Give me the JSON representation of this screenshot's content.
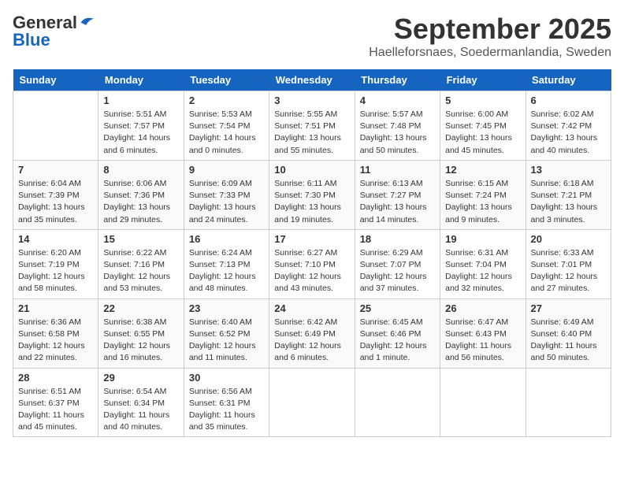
{
  "header": {
    "logo_line1": "General",
    "logo_line2": "Blue",
    "month": "September 2025",
    "location": "Haelleforsnaes, Soedermanlandia, Sweden"
  },
  "columns": [
    "Sunday",
    "Monday",
    "Tuesday",
    "Wednesday",
    "Thursday",
    "Friday",
    "Saturday"
  ],
  "weeks": [
    [
      {
        "day": "",
        "info": ""
      },
      {
        "day": "1",
        "info": "Sunrise: 5:51 AM\nSunset: 7:57 PM\nDaylight: 14 hours\nand 6 minutes."
      },
      {
        "day": "2",
        "info": "Sunrise: 5:53 AM\nSunset: 7:54 PM\nDaylight: 14 hours\nand 0 minutes."
      },
      {
        "day": "3",
        "info": "Sunrise: 5:55 AM\nSunset: 7:51 PM\nDaylight: 13 hours\nand 55 minutes."
      },
      {
        "day": "4",
        "info": "Sunrise: 5:57 AM\nSunset: 7:48 PM\nDaylight: 13 hours\nand 50 minutes."
      },
      {
        "day": "5",
        "info": "Sunrise: 6:00 AM\nSunset: 7:45 PM\nDaylight: 13 hours\nand 45 minutes."
      },
      {
        "day": "6",
        "info": "Sunrise: 6:02 AM\nSunset: 7:42 PM\nDaylight: 13 hours\nand 40 minutes."
      }
    ],
    [
      {
        "day": "7",
        "info": "Sunrise: 6:04 AM\nSunset: 7:39 PM\nDaylight: 13 hours\nand 35 minutes."
      },
      {
        "day": "8",
        "info": "Sunrise: 6:06 AM\nSunset: 7:36 PM\nDaylight: 13 hours\nand 29 minutes."
      },
      {
        "day": "9",
        "info": "Sunrise: 6:09 AM\nSunset: 7:33 PM\nDaylight: 13 hours\nand 24 minutes."
      },
      {
        "day": "10",
        "info": "Sunrise: 6:11 AM\nSunset: 7:30 PM\nDaylight: 13 hours\nand 19 minutes."
      },
      {
        "day": "11",
        "info": "Sunrise: 6:13 AM\nSunset: 7:27 PM\nDaylight: 13 hours\nand 14 minutes."
      },
      {
        "day": "12",
        "info": "Sunrise: 6:15 AM\nSunset: 7:24 PM\nDaylight: 13 hours\nand 9 minutes."
      },
      {
        "day": "13",
        "info": "Sunrise: 6:18 AM\nSunset: 7:21 PM\nDaylight: 13 hours\nand 3 minutes."
      }
    ],
    [
      {
        "day": "14",
        "info": "Sunrise: 6:20 AM\nSunset: 7:19 PM\nDaylight: 12 hours\nand 58 minutes."
      },
      {
        "day": "15",
        "info": "Sunrise: 6:22 AM\nSunset: 7:16 PM\nDaylight: 12 hours\nand 53 minutes."
      },
      {
        "day": "16",
        "info": "Sunrise: 6:24 AM\nSunset: 7:13 PM\nDaylight: 12 hours\nand 48 minutes."
      },
      {
        "day": "17",
        "info": "Sunrise: 6:27 AM\nSunset: 7:10 PM\nDaylight: 12 hours\nand 43 minutes."
      },
      {
        "day": "18",
        "info": "Sunrise: 6:29 AM\nSunset: 7:07 PM\nDaylight: 12 hours\nand 37 minutes."
      },
      {
        "day": "19",
        "info": "Sunrise: 6:31 AM\nSunset: 7:04 PM\nDaylight: 12 hours\nand 32 minutes."
      },
      {
        "day": "20",
        "info": "Sunrise: 6:33 AM\nSunset: 7:01 PM\nDaylight: 12 hours\nand 27 minutes."
      }
    ],
    [
      {
        "day": "21",
        "info": "Sunrise: 6:36 AM\nSunset: 6:58 PM\nDaylight: 12 hours\nand 22 minutes."
      },
      {
        "day": "22",
        "info": "Sunrise: 6:38 AM\nSunset: 6:55 PM\nDaylight: 12 hours\nand 16 minutes."
      },
      {
        "day": "23",
        "info": "Sunrise: 6:40 AM\nSunset: 6:52 PM\nDaylight: 12 hours\nand 11 minutes."
      },
      {
        "day": "24",
        "info": "Sunrise: 6:42 AM\nSunset: 6:49 PM\nDaylight: 12 hours\nand 6 minutes."
      },
      {
        "day": "25",
        "info": "Sunrise: 6:45 AM\nSunset: 6:46 PM\nDaylight: 12 hours\nand 1 minute."
      },
      {
        "day": "26",
        "info": "Sunrise: 6:47 AM\nSunset: 6:43 PM\nDaylight: 11 hours\nand 56 minutes."
      },
      {
        "day": "27",
        "info": "Sunrise: 6:49 AM\nSunset: 6:40 PM\nDaylight: 11 hours\nand 50 minutes."
      }
    ],
    [
      {
        "day": "28",
        "info": "Sunrise: 6:51 AM\nSunset: 6:37 PM\nDaylight: 11 hours\nand 45 minutes."
      },
      {
        "day": "29",
        "info": "Sunrise: 6:54 AM\nSunset: 6:34 PM\nDaylight: 11 hours\nand 40 minutes."
      },
      {
        "day": "30",
        "info": "Sunrise: 6:56 AM\nSunset: 6:31 PM\nDaylight: 11 hours\nand 35 minutes."
      },
      {
        "day": "",
        "info": ""
      },
      {
        "day": "",
        "info": ""
      },
      {
        "day": "",
        "info": ""
      },
      {
        "day": "",
        "info": ""
      }
    ]
  ]
}
